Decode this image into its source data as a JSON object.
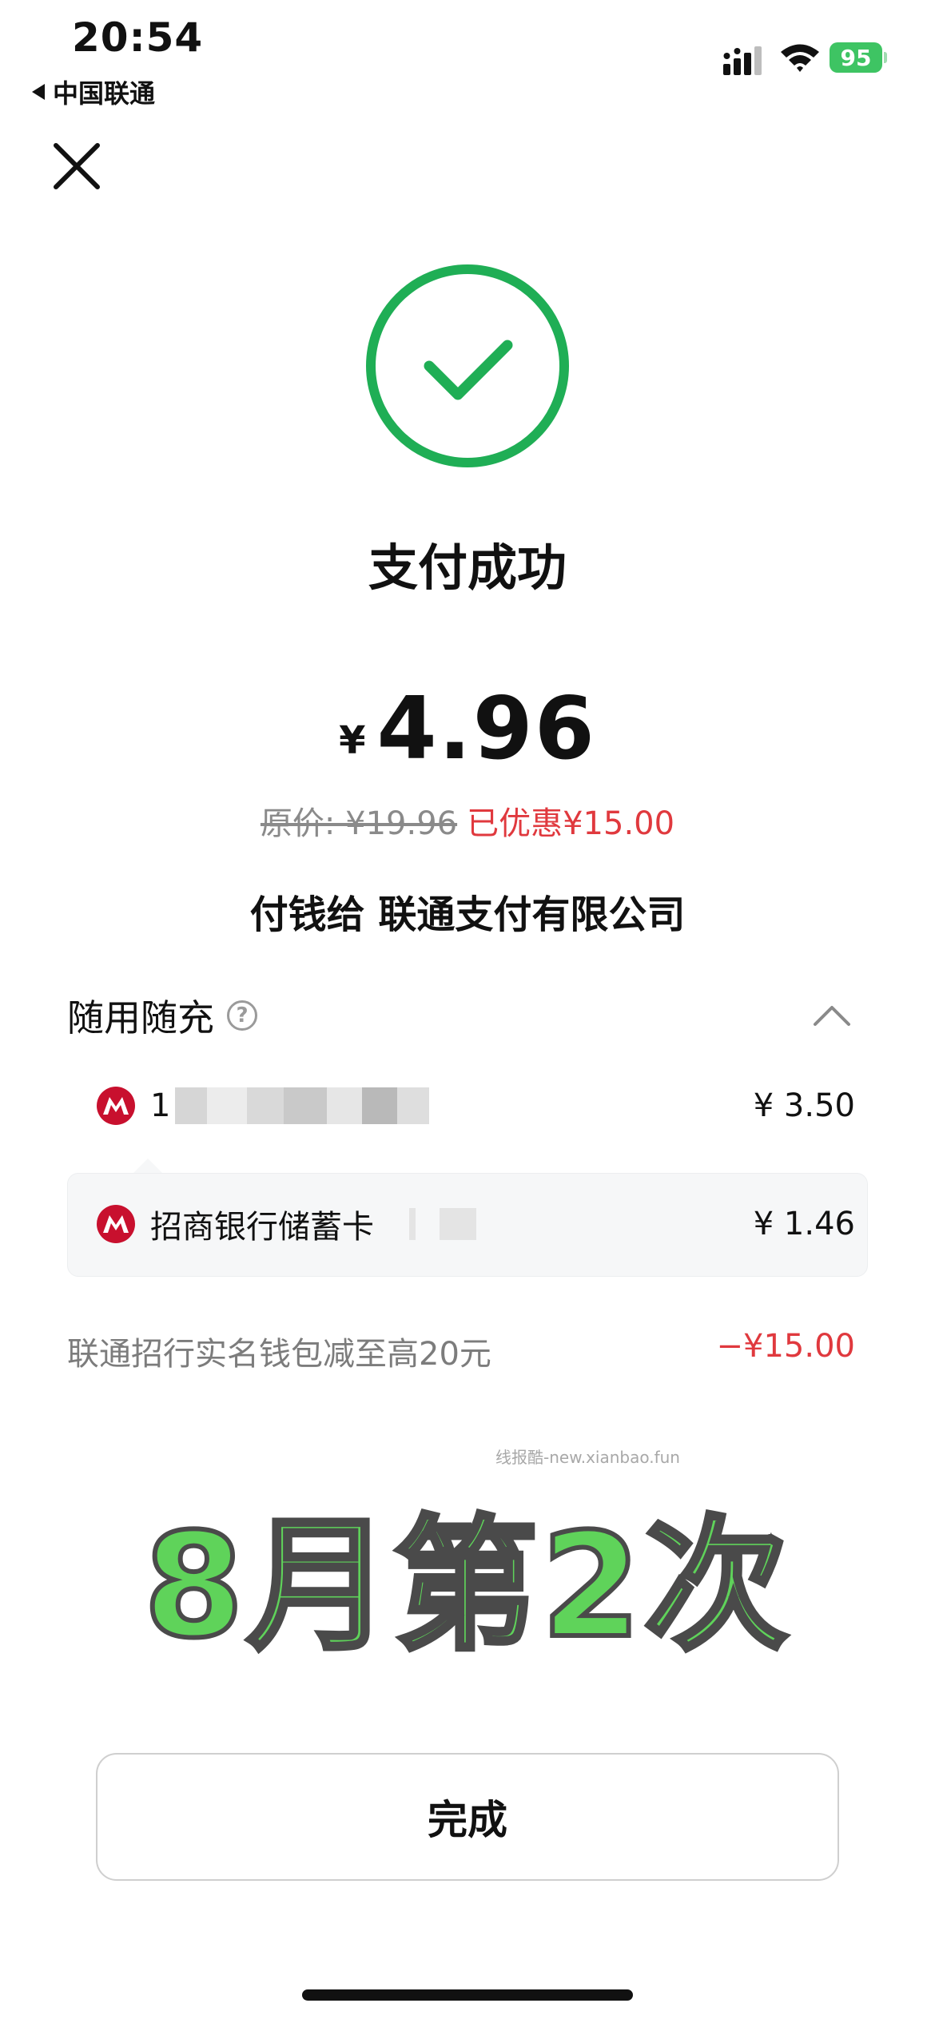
{
  "status_bar": {
    "time": "20:54",
    "carrier": "中国联通",
    "battery": "95"
  },
  "result": {
    "title": "支付成功",
    "currency": "¥",
    "amount": "4.96",
    "original_price": "原价: ¥19.96",
    "saved": "已优惠¥15.00",
    "payee": "付钱给 联通支付有限公司"
  },
  "payment": {
    "section_title": "随用随充",
    "help_glyph": "?",
    "items": [
      {
        "label": "1",
        "amount": "¥ 3.50",
        "masked": true
      },
      {
        "label": "招商银行储蓄卡",
        "amount": "¥ 1.46"
      }
    ]
  },
  "promotion": {
    "label": "联通招行实名钱包减至高20元",
    "amount": "−¥15.00"
  },
  "watermark": "线报酷-new.xianbao.fun",
  "overlay_text": "8月第2次",
  "done_button": "完成",
  "colors": {
    "success_green": "#1fae55",
    "discount_red": "#e0393e",
    "bank_red": "#c8102e",
    "overlay_green": "#5fd35a"
  }
}
